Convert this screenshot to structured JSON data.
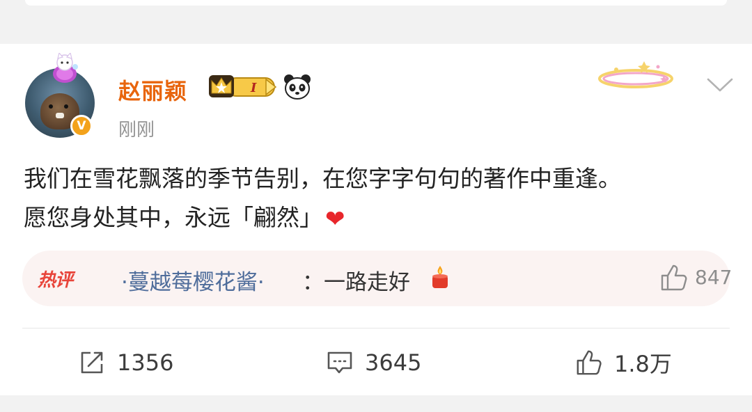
{
  "post": {
    "username": "赵丽颖",
    "timestamp": "刚刚",
    "text_line1": "我们在雪花飘落的季节告别，在您字字句句的著作中重逢。",
    "text_line2": "愿您身处其中，永远「翩然」",
    "heart": "❤",
    "verified_mark": "V",
    "icons": [
      "cat-pendant-icon",
      "crown-level-badge",
      "panda-icon",
      "more-chevron-icon",
      "heart-icon"
    ]
  },
  "hot_comment": {
    "label": "热评",
    "author": "·蔓越莓樱花酱·",
    "body": "：一路走好",
    "like_count": "847",
    "icons": [
      "candle-icon",
      "thumb-up-icon"
    ]
  },
  "actions": {
    "repost_count": "1356",
    "comment_count": "3645",
    "like_count": "1.8万",
    "icons": [
      "repost-icon",
      "comment-icon",
      "like-icon"
    ]
  },
  "colors": {
    "username": "#e8650d",
    "hot_label": "#e8443a",
    "comment_author": "#4f6d9b",
    "background": "#f2f2f2"
  }
}
